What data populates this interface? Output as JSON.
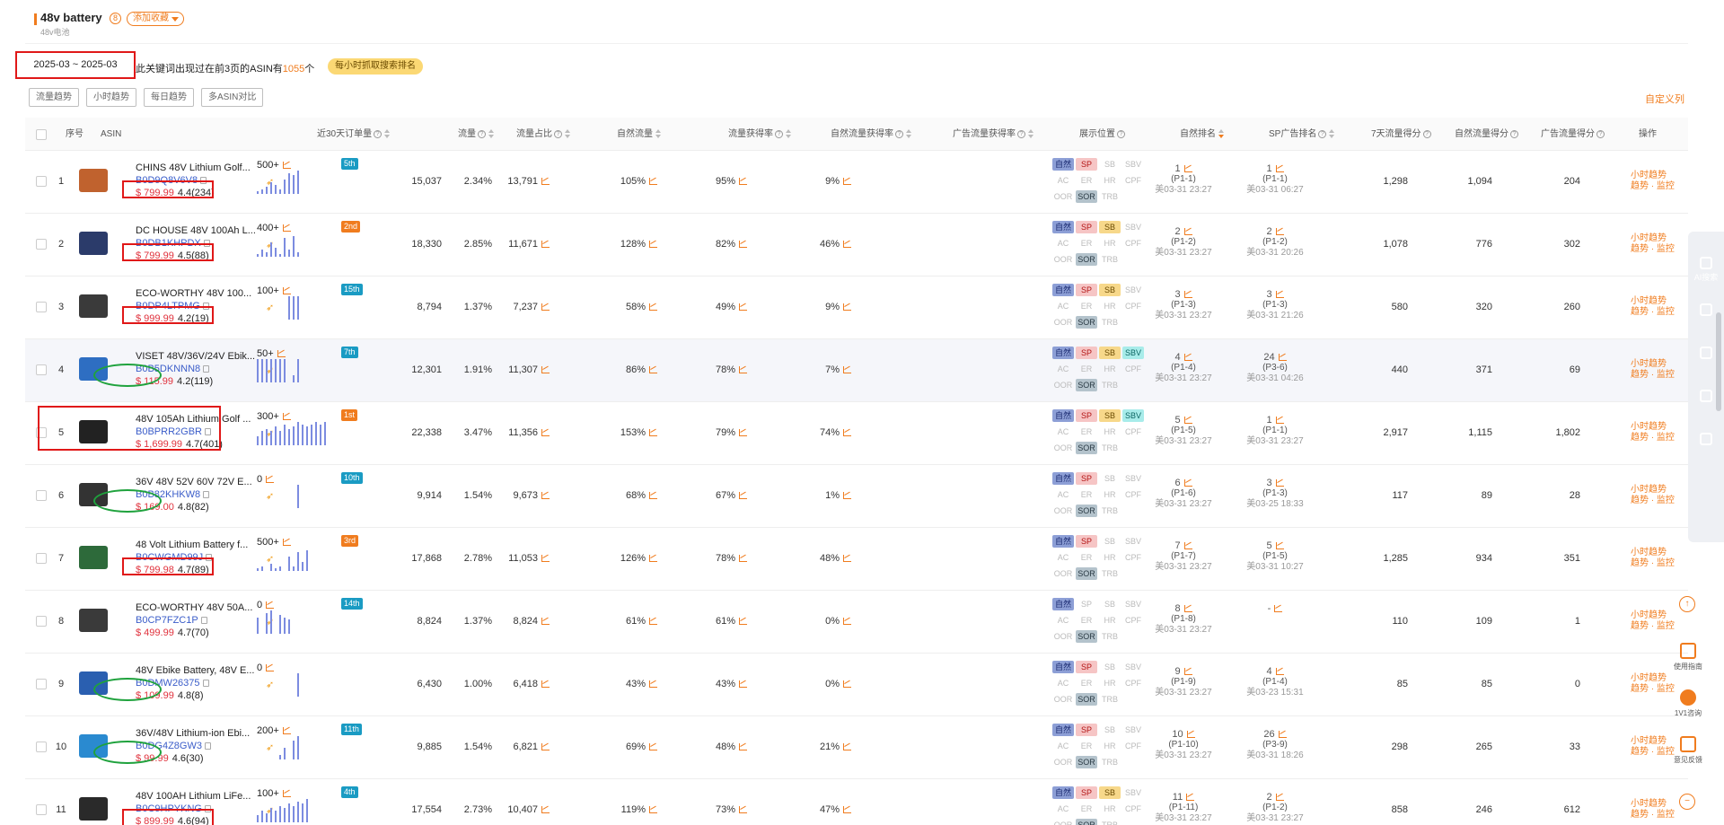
{
  "header": {
    "title": "48v battery",
    "subtitle": "48v电池",
    "fav_label": "添加收藏",
    "info_glyph": "8"
  },
  "toolbar": {
    "date_range": "2025-03 ~ 2025-03",
    "summary_prefix": "此关键词出现过在前3页的ASIN有",
    "summary_count": "1055",
    "summary_suffix": "个",
    "hourly_btn": "每小时抓取搜索排名",
    "tabs": [
      "流量趋势",
      "小时趋势",
      "每日趋势",
      "多ASIN对比"
    ],
    "custom_cols": "自定义列"
  },
  "columns": {
    "seq": "序号",
    "asin": "ASIN",
    "sales30": "近30天订单量",
    "traffic": "流量",
    "share": "流量占比",
    "organic": "自然流量",
    "capture": "流量获得率",
    "org_capture": "自然流量获得率",
    "ad_capture": "广告流量获得率",
    "position": "展示位置",
    "org_rank": "自然排名",
    "sp_rank": "SP广告排名",
    "score7": "7天流量得分",
    "org_score": "自然流量得分",
    "ad_score": "广告流量得分",
    "action": "操作"
  },
  "tag_labels": [
    "自然",
    "SP",
    "SB",
    "SBV",
    "AC",
    "ER",
    "HR",
    "CPF",
    "OOR",
    "SOR",
    "TRB"
  ],
  "ops": {
    "hourly": "小时趋势",
    "monitor": "趋势 · 监控"
  },
  "colors": {
    "accent": "#f07c1e",
    "price": "#e0323d",
    "asin": "#3b5dc9",
    "bar": "#7c8ce0",
    "mark_red": "#e01818",
    "mark_green": "#1fa23d"
  },
  "rows": [
    {
      "seq": "1",
      "name": "CHINS 48V Lithium Golf...",
      "asin": "B0D9Q8V6V8",
      "price": "$ 799.99",
      "rating": "4.4(234)",
      "sales": "500+",
      "bars": [
        1,
        2,
        3,
        5,
        4,
        2,
        6,
        9,
        8,
        10
      ],
      "badge": "5th",
      "badge_color": "teal",
      "traffic": "15,037",
      "share": "2.34%",
      "organic": "13,791",
      "capture": "105%",
      "org_capture": "95%",
      "ad_capture": "9%",
      "tags": [
        1,
        1,
        0,
        0,
        0,
        0,
        0,
        0,
        0,
        1,
        0
      ],
      "org_rank": "1",
      "org_pg": "(P1-1)",
      "org_tm": "美03-31 23:27",
      "sp_rank": "1",
      "sp_pg": "(P1-1)",
      "sp_tm": "美03-31 06:27",
      "score7": "1,298",
      "org_score": "1,094",
      "ad_score": "204",
      "thumb": "#c0622e",
      "mark": "red",
      "hl": false
    },
    {
      "seq": "2",
      "name": "DC HOUSE 48V 100Ah L...",
      "asin": "B0DB1KHPDX",
      "price": "$ 799.99",
      "rating": "4.5(88)",
      "sales": "400+",
      "bars": [
        1,
        3,
        2,
        6,
        4,
        1,
        8,
        3,
        9,
        2
      ],
      "badge": "2nd",
      "badge_color": "orange",
      "traffic": "18,330",
      "share": "2.85%",
      "organic": "11,671",
      "capture": "128%",
      "org_capture": "82%",
      "ad_capture": "46%",
      "tags": [
        1,
        1,
        1,
        0,
        0,
        0,
        0,
        0,
        0,
        1,
        0
      ],
      "org_rank": "2",
      "org_pg": "(P1-2)",
      "org_tm": "美03-31 23:27",
      "sp_rank": "2",
      "sp_pg": "(P1-2)",
      "sp_tm": "美03-31 20:26",
      "score7": "1,078",
      "org_score": "776",
      "ad_score": "302",
      "thumb": "#2b3b6a",
      "mark": "red",
      "hl": false
    },
    {
      "seq": "3",
      "name": "ECO-WORTHY 48V 100...",
      "asin": "B0DP4LTPMG",
      "price": "$ 999.99",
      "rating": "4.2(19)",
      "sales": "100+",
      "bars": [
        0,
        0,
        0,
        0,
        0,
        0,
        0,
        10,
        10,
        10
      ],
      "badge": "15th",
      "badge_color": "teal",
      "traffic": "8,794",
      "share": "1.37%",
      "organic": "7,237",
      "capture": "58%",
      "org_capture": "49%",
      "ad_capture": "9%",
      "tags": [
        1,
        1,
        1,
        0,
        0,
        0,
        0,
        0,
        0,
        1,
        0
      ],
      "org_rank": "3",
      "org_pg": "(P1-3)",
      "org_tm": "美03-31 23:27",
      "sp_rank": "3",
      "sp_pg": "(P1-3)",
      "sp_tm": "美03-31 21:26",
      "score7": "580",
      "org_score": "320",
      "ad_score": "260",
      "thumb": "#3a3a3a",
      "mark": "red",
      "hl": false
    },
    {
      "seq": "4",
      "name": "VISET 48V/36V/24V Ebik...",
      "asin": "B0B5DKNNN8",
      "price": "$ 115.99",
      "rating": "4.2(119)",
      "sales": "50+",
      "bars": [
        10,
        10,
        10,
        10,
        10,
        10,
        10,
        0,
        3,
        10
      ],
      "badge": "7th",
      "badge_color": "teal",
      "traffic": "12,301",
      "share": "1.91%",
      "organic": "11,307",
      "capture": "86%",
      "org_capture": "78%",
      "ad_capture": "7%",
      "tags": [
        1,
        1,
        1,
        1,
        0,
        0,
        0,
        0,
        0,
        1,
        0
      ],
      "org_rank": "4",
      "org_pg": "(P1-4)",
      "org_tm": "美03-31 23:27",
      "sp_rank": "24",
      "sp_pg": "(P3-6)",
      "sp_tm": "美03-31 04:26",
      "score7": "440",
      "org_score": "371",
      "ad_score": "69",
      "thumb": "#2e6ec2",
      "mark": "green",
      "hl": true
    },
    {
      "seq": "5",
      "name": "48V 105Ah Lithium Golf ...",
      "asin": "B0BPRR2GBR",
      "price": "$ 1,699.99",
      "rating": "4.7(401)",
      "sales": "300+",
      "bars": [
        4,
        6,
        7,
        6,
        8,
        6,
        9,
        7,
        8,
        10,
        9,
        8,
        9,
        10,
        9,
        10
      ],
      "badge": "1st",
      "badge_color": "orange",
      "traffic": "22,338",
      "share": "3.47%",
      "organic": "11,356",
      "capture": "153%",
      "org_capture": "79%",
      "ad_capture": "74%",
      "tags": [
        1,
        1,
        1,
        1,
        0,
        0,
        0,
        0,
        0,
        1,
        0
      ],
      "org_rank": "5",
      "org_pg": "(P1-5)",
      "org_tm": "美03-31 23:27",
      "sp_rank": "1",
      "sp_pg": "(P1-1)",
      "sp_tm": "美03-31 23:27",
      "score7": "2,917",
      "org_score": "1,115",
      "ad_score": "1,802",
      "thumb": "#222222",
      "mark": "redbig",
      "hl": false
    },
    {
      "seq": "6",
      "name": "36V 48V 52V 60V 72V E...",
      "asin": "B0B82KHKW8",
      "price": "$ 169.00",
      "rating": "4.8(82)",
      "sales": "0",
      "bars": [
        0,
        0,
        0,
        0,
        0,
        0,
        0,
        0,
        0,
        10
      ],
      "badge": "10th",
      "badge_color": "teal",
      "traffic": "9,914",
      "share": "1.54%",
      "organic": "9,673",
      "capture": "68%",
      "org_capture": "67%",
      "ad_capture": "1%",
      "tags": [
        1,
        1,
        0,
        0,
        0,
        0,
        0,
        0,
        0,
        1,
        0
      ],
      "org_rank": "6",
      "org_pg": "(P1-6)",
      "org_tm": "美03-31 23:27",
      "sp_rank": "3",
      "sp_pg": "(P1-3)",
      "sp_tm": "美03-25 18:33",
      "score7": "117",
      "org_score": "89",
      "ad_score": "28",
      "thumb": "#333333",
      "mark": "green",
      "hl": false
    },
    {
      "seq": "7",
      "name": "48 Volt Lithium Battery f...",
      "asin": "B0CWGMD99J",
      "price": "$ 799.98",
      "rating": "4.7(89)",
      "sales": "500+",
      "bars": [
        1,
        2,
        0,
        3,
        1,
        2,
        0,
        6,
        2,
        8,
        4,
        9
      ],
      "badge": "3rd",
      "badge_color": "orange",
      "traffic": "17,868",
      "share": "2.78%",
      "organic": "11,053",
      "capture": "126%",
      "org_capture": "78%",
      "ad_capture": "48%",
      "tags": [
        1,
        1,
        0,
        0,
        0,
        0,
        0,
        0,
        0,
        1,
        0
      ],
      "org_rank": "7",
      "org_pg": "(P1-7)",
      "org_tm": "美03-31 23:27",
      "sp_rank": "5",
      "sp_pg": "(P1-5)",
      "sp_tm": "美03-31 10:27",
      "score7": "1,285",
      "org_score": "934",
      "ad_score": "351",
      "thumb": "#2d6a3a",
      "mark": "red",
      "hl": false
    },
    {
      "seq": "8",
      "name": "ECO-WORTHY 48V 50A...",
      "asin": "B0CP7FZC1P",
      "price": "$ 499.99",
      "rating": "4.7(70)",
      "sales": "0",
      "bars": [
        7,
        0,
        9,
        10,
        0,
        8,
        7,
        6,
        0,
        0,
        0,
        0
      ],
      "badge": "14th",
      "badge_color": "teal",
      "traffic": "8,824",
      "share": "1.37%",
      "organic": "8,824",
      "capture": "61%",
      "org_capture": "61%",
      "ad_capture": "0%",
      "tags": [
        1,
        0,
        0,
        0,
        0,
        0,
        0,
        0,
        0,
        1,
        0
      ],
      "org_rank": "8",
      "org_pg": "(P1-8)",
      "org_tm": "美03-31 23:27",
      "sp_rank": "-",
      "sp_pg": "",
      "sp_tm": "",
      "score7": "110",
      "org_score": "109",
      "ad_score": "1",
      "thumb": "#3a3a3a",
      "mark": "none",
      "hl": false
    },
    {
      "seq": "9",
      "name": "48V Ebike Battery, 48V E...",
      "asin": "B0DMW26375",
      "price": "$ 109.99",
      "rating": "4.8(8)",
      "sales": "0",
      "bars": [
        0,
        0,
        0,
        0,
        0,
        0,
        0,
        0,
        0,
        10
      ],
      "badge": "",
      "badge_color": "teal",
      "traffic": "6,430",
      "share": "1.00%",
      "organic": "6,418",
      "capture": "43%",
      "org_capture": "43%",
      "ad_capture": "0%",
      "tags": [
        1,
        1,
        0,
        0,
        0,
        0,
        0,
        0,
        0,
        1,
        0
      ],
      "org_rank": "9",
      "org_pg": "(P1-9)",
      "org_tm": "美03-31 23:27",
      "sp_rank": "4",
      "sp_pg": "(P1-4)",
      "sp_tm": "美03-23 15:31",
      "score7": "85",
      "org_score": "85",
      "ad_score": "0",
      "thumb": "#2a5fb0",
      "mark": "green",
      "hl": false
    },
    {
      "seq": "10",
      "name": "36V/48V Lithium-ion Ebi...",
      "asin": "B0DG4Z8GW3",
      "price": "$ 99.99",
      "rating": "4.6(30)",
      "sales": "200+",
      "bars": [
        0,
        0,
        0,
        0,
        0,
        2,
        5,
        0,
        8,
        10
      ],
      "badge": "11th",
      "badge_color": "teal",
      "traffic": "9,885",
      "share": "1.54%",
      "organic": "6,821",
      "capture": "69%",
      "org_capture": "48%",
      "ad_capture": "21%",
      "tags": [
        1,
        1,
        0,
        0,
        0,
        0,
        0,
        0,
        0,
        1,
        0
      ],
      "org_rank": "10",
      "org_pg": "(P1-10)",
      "org_tm": "美03-31 23:27",
      "sp_rank": "26",
      "sp_pg": "(P3-9)",
      "sp_tm": "美03-31 18:26",
      "score7": "298",
      "org_score": "265",
      "ad_score": "33",
      "thumb": "#2a8ad0",
      "mark": "green",
      "hl": false
    },
    {
      "seq": "11",
      "name": "48V 100AH Lithium LiFe...",
      "asin": "B0C9HPYKNG",
      "price": "$ 899.99",
      "rating": "4.6(94)",
      "sales": "100+",
      "bars": [
        3,
        5,
        4,
        6,
        5,
        7,
        6,
        8,
        7,
        9,
        8,
        10
      ],
      "badge": "4th",
      "badge_color": "teal",
      "traffic": "17,554",
      "share": "2.73%",
      "organic": "10,407",
      "capture": "119%",
      "org_capture": "73%",
      "ad_capture": "47%",
      "tags": [
        1,
        1,
        1,
        0,
        0,
        0,
        0,
        0,
        0,
        1,
        0
      ],
      "org_rank": "11",
      "org_pg": "(P1-11)",
      "org_tm": "美03-31 23:27",
      "sp_rank": "2",
      "sp_pg": "(P1-2)",
      "sp_tm": "美03-31 23:27",
      "score7": "858",
      "org_score": "246",
      "ad_score": "612",
      "thumb": "#2a2a2a",
      "mark": "red",
      "hl": false
    }
  ],
  "side": {
    "ai_search": "AI搜索",
    "help": "使用指南",
    "consult": "1V1咨询",
    "feedback": "意见反馈"
  }
}
